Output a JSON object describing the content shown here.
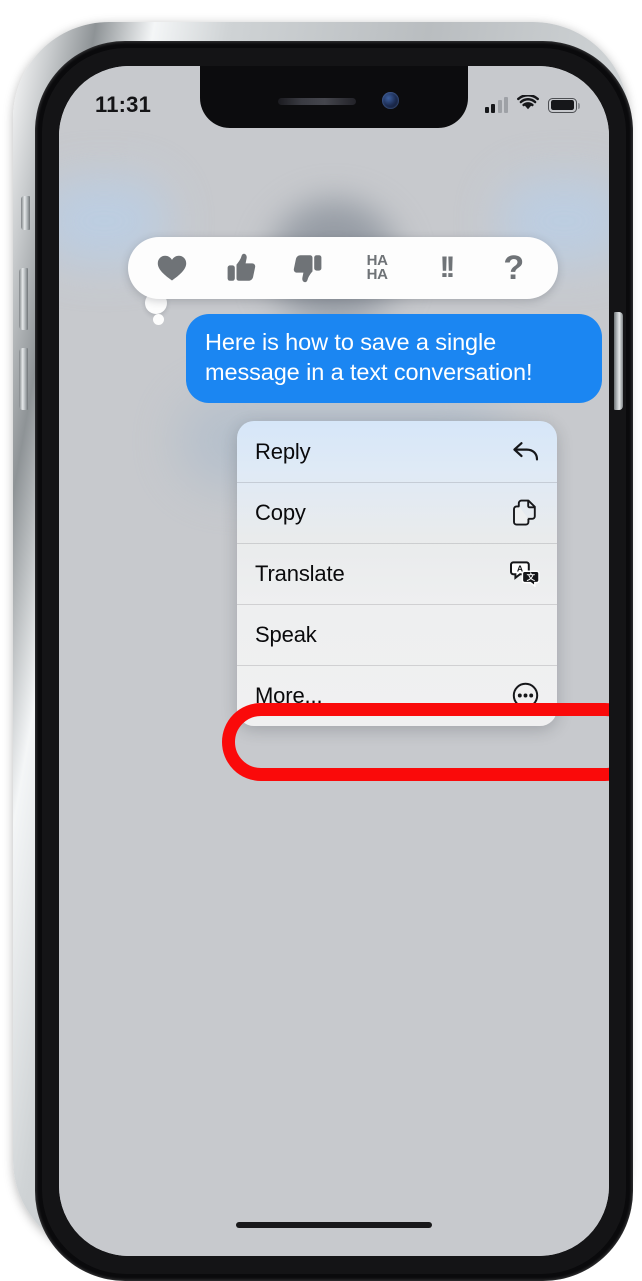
{
  "device": {
    "name": "iPhone",
    "frame_color": "#b9bdc0"
  },
  "status_bar": {
    "time": "11:31",
    "cellular_icon": "cellular-signal-icon",
    "cellular_bars_filled": 2,
    "cellular_bars_total": 4,
    "wifi_icon": "wifi-icon",
    "battery_icon": "battery-icon",
    "battery_level_percent": 100
  },
  "tapback_bar": {
    "name": "tapback-reaction-bar",
    "reactions": [
      {
        "id": "heart",
        "icon": "heart-icon",
        "label": "Love"
      },
      {
        "id": "thumbs-up",
        "icon": "thumbs-up-icon",
        "label": "Like"
      },
      {
        "id": "thumbs-down",
        "icon": "thumbs-down-icon",
        "label": "Dislike"
      },
      {
        "id": "haha",
        "icon": "haha-icon",
        "label_line1": "HA",
        "label_line2": "HA"
      },
      {
        "id": "exclamation",
        "icon": "double-exclamation-icon",
        "label": "!!"
      },
      {
        "id": "question",
        "icon": "question-mark-icon",
        "label": "?"
      }
    ]
  },
  "message": {
    "text": "Here is how to save a single message in a text conversation!",
    "sender": "outgoing",
    "bubble_color": "#1b86f2",
    "text_color": "#ffffff"
  },
  "context_menu": {
    "items": [
      {
        "label": "Reply",
        "icon": "reply-arrow-icon"
      },
      {
        "label": "Copy",
        "icon": "copy-documents-icon"
      },
      {
        "label": "Translate",
        "icon": "translate-bubbles-icon"
      },
      {
        "label": "Speak",
        "icon": "none"
      },
      {
        "label": "More...",
        "icon": "ellipsis-circle-icon"
      }
    ]
  },
  "annotation": {
    "target_label": "More...",
    "shape": "rounded-rectangle-outline",
    "color": "#fa0a0a"
  },
  "home_indicator": {
    "name": "home-indicator"
  }
}
